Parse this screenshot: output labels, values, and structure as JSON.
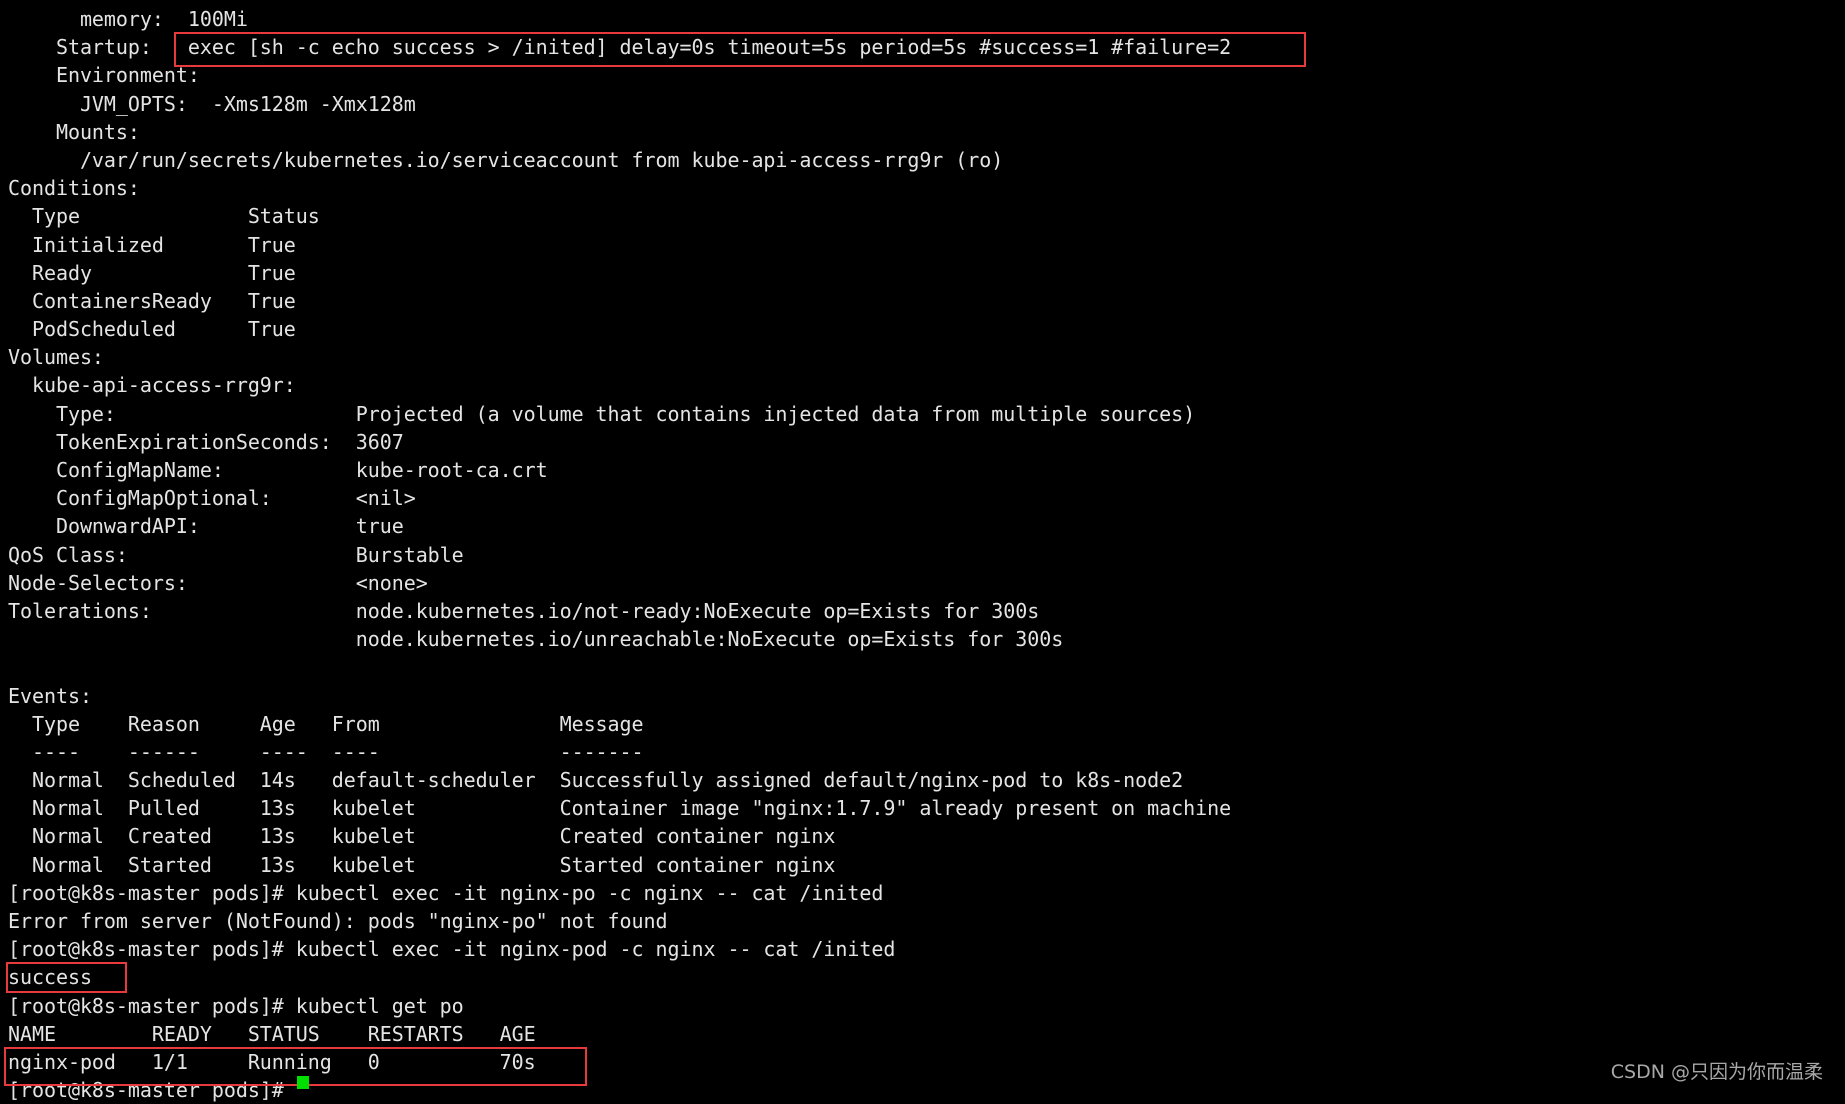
{
  "terminal": {
    "lines": [
      "      memory:  100Mi",
      "    Startup:   exec [sh -c echo success > /inited] delay=0s timeout=5s period=5s #success=1 #failure=2",
      "    Environment:",
      "      JVM_OPTS:  -Xms128m -Xmx128m",
      "    Mounts:",
      "      /var/run/secrets/kubernetes.io/serviceaccount from kube-api-access-rrg9r (ro)",
      "Conditions:",
      "  Type              Status",
      "  Initialized       True",
      "  Ready             True",
      "  ContainersReady   True",
      "  PodScheduled      True",
      "Volumes:",
      "  kube-api-access-rrg9r:",
      "    Type:                    Projected (a volume that contains injected data from multiple sources)",
      "    TokenExpirationSeconds:  3607",
      "    ConfigMapName:           kube-root-ca.crt",
      "    ConfigMapOptional:       <nil>",
      "    DownwardAPI:             true",
      "QoS Class:                   Burstable",
      "Node-Selectors:              <none>",
      "Tolerations:                 node.kubernetes.io/not-ready:NoExecute op=Exists for 300s",
      "                             node.kubernetes.io/unreachable:NoExecute op=Exists for 300s",
      "",
      "Events:",
      "  Type    Reason     Age   From               Message",
      "  ----    ------     ----  ----               -------",
      "  Normal  Scheduled  14s   default-scheduler  Successfully assigned default/nginx-pod to k8s-node2",
      "  Normal  Pulled     13s   kubelet            Container image \"nginx:1.7.9\" already present on machine",
      "  Normal  Created    13s   kubelet            Created container nginx",
      "  Normal  Started    13s   kubelet            Started container nginx",
      "[root@k8s-master pods]# kubectl exec -it nginx-po -c nginx -- cat /inited",
      "Error from server (NotFound): pods \"nginx-po\" not found",
      "[root@k8s-master pods]# kubectl exec -it nginx-pod -c nginx -- cat /inited",
      "success",
      "[root@k8s-master pods]# kubectl get po",
      "NAME        READY   STATUS    RESTARTS   AGE",
      "nginx-pod   1/1     Running   0          70s",
      "[root@k8s-master pods]# "
    ]
  },
  "watermark": "CSDN @只因为你而温柔",
  "colors": {
    "background": "#000000",
    "text": "#e4e4e4",
    "highlight_box": "#e83a3c",
    "cursor": "#00e000"
  }
}
